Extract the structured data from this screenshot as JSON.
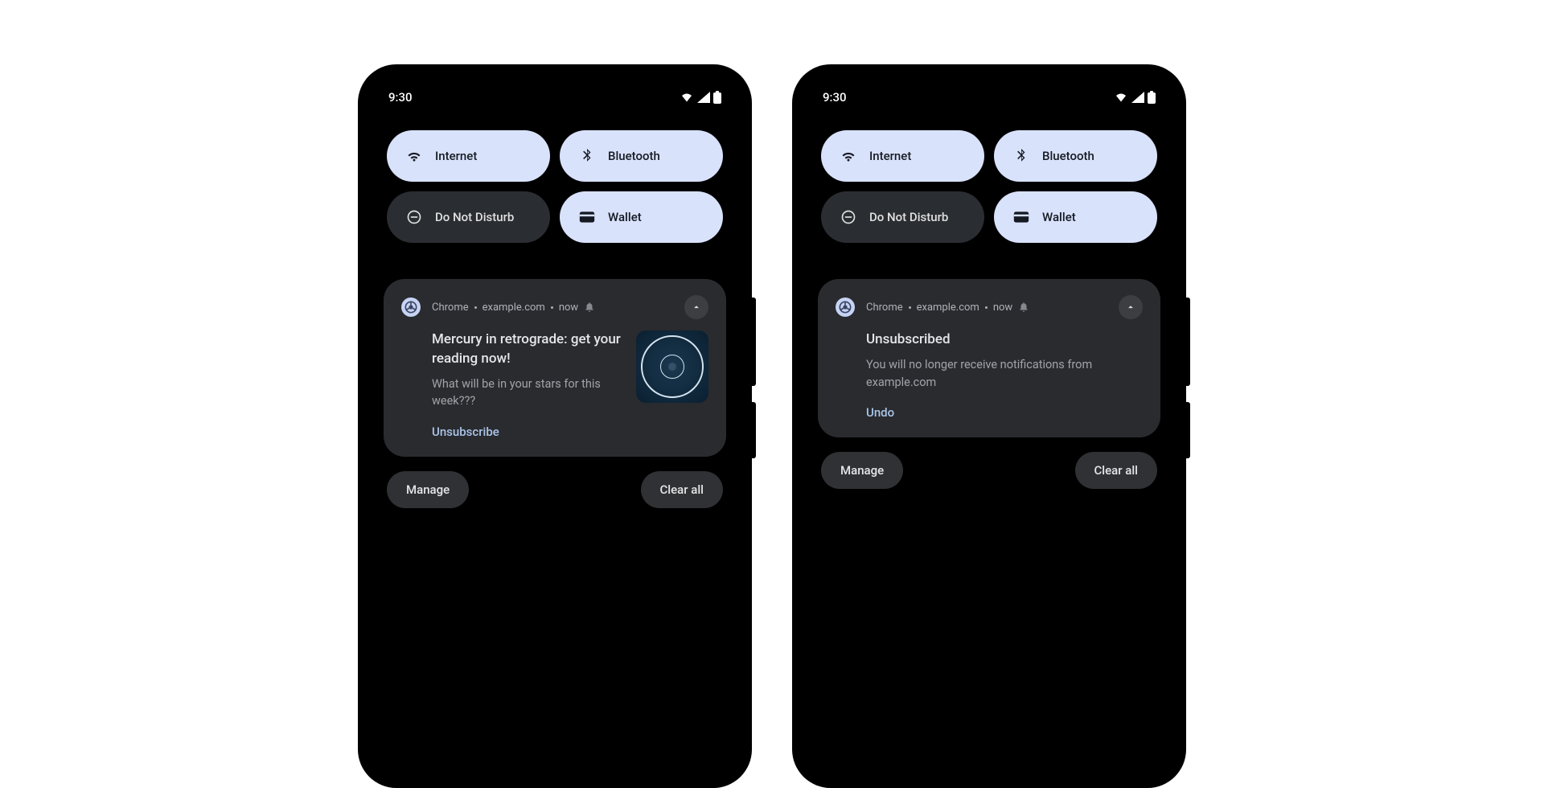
{
  "status": {
    "time": "9:30"
  },
  "qs": {
    "internet": "Internet",
    "bluetooth": "Bluetooth",
    "dnd": "Do Not Disturb",
    "wallet": "Wallet"
  },
  "notif_header": {
    "app": "Chrome",
    "source": "example.com",
    "time": "now"
  },
  "left_notif": {
    "title": "Mercury in retrograde: get your reading now!",
    "body": "What will be in your stars for this week???",
    "action": "Unsubscribe"
  },
  "right_notif": {
    "title": "Unsubscribed",
    "body": "You will no longer receive notifications from example.com",
    "action": "Undo"
  },
  "buttons": {
    "manage": "Manage",
    "clear_all": "Clear all"
  },
  "colors": {
    "tile_active": "#d9e2fb",
    "tile_inactive": "#2a2d31",
    "card": "#292b2f",
    "action": "#abc5e9"
  }
}
